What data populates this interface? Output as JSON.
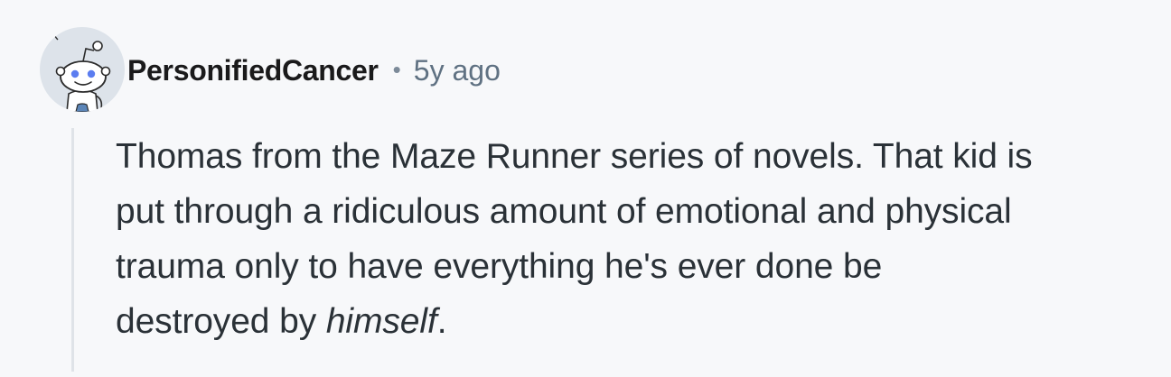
{
  "comment": {
    "username": "PersonifiedCancer",
    "separator": "•",
    "timestamp": "5y ago",
    "avatar_icon": "snoo-avatar-icon",
    "body_lines": [
      "Thomas from the Maze Runner series of novels. That kid is",
      "put through a ridiculous amount of emotional and physical",
      "trauma only to have everything he's ever done be"
    ],
    "body_last_prefix": "destroyed by ",
    "body_emphasis": "himself",
    "body_last_suffix": "."
  },
  "colors": {
    "background": "#f7f8fa",
    "username": "#1a1a1b",
    "meta": "#5f7182",
    "body_text": "#2a3137",
    "thread_line": "#dfe3e8",
    "avatar_eye": "#5b7df0"
  }
}
